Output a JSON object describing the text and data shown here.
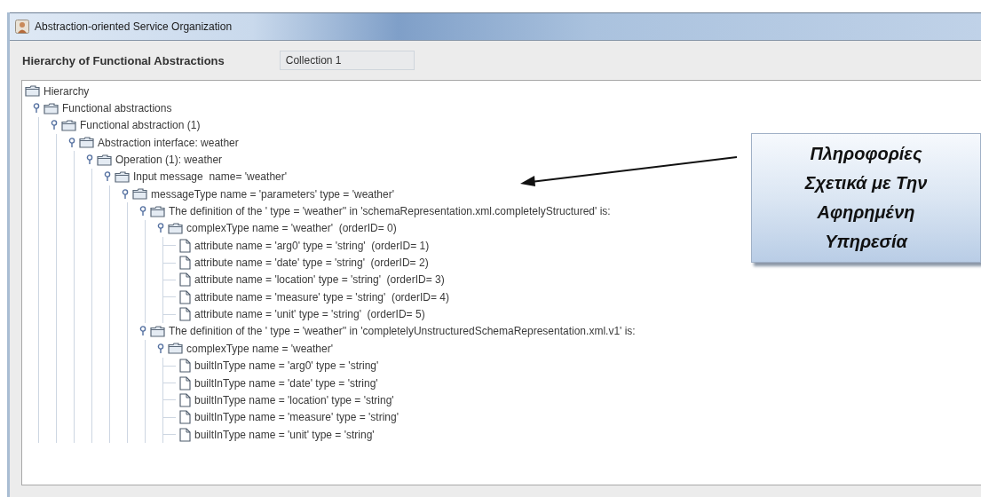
{
  "window": {
    "title": "Abstraction-oriented Service Organization"
  },
  "header": {
    "label": "Hierarchy of Functional Abstractions",
    "field": {
      "value": "Collection 1"
    }
  },
  "tree": {
    "kind": "folder",
    "label": "Hierarchy",
    "children": [
      {
        "kind": "folder",
        "label": "Functional abstractions",
        "expanded": true,
        "children": [
          {
            "kind": "folder",
            "label": "Functional abstraction (1)",
            "expanded": true,
            "children": [
              {
                "kind": "folder",
                "label": "Abstraction interface: weather",
                "expanded": true,
                "children": [
                  {
                    "kind": "folder",
                    "label": "Operation (1): weather",
                    "expanded": true,
                    "children": [
                      {
                        "kind": "folder",
                        "label": "Input message  name= 'weather'",
                        "expanded": true,
                        "children": [
                          {
                            "kind": "folder",
                            "label": "messageType name = 'parameters' type = 'weather'",
                            "expanded": true,
                            "children": [
                              {
                                "kind": "folder",
                                "label": "The definition of the ' type = 'weather'' in 'schemaRepresentation.xml.completelyStructured' is:",
                                "expanded": true,
                                "children": [
                                  {
                                    "kind": "folder",
                                    "label": "complexType name = 'weather'  (orderID= 0)",
                                    "expanded": true,
                                    "children": [
                                      {
                                        "kind": "file",
                                        "label": "attribute name = 'arg0' type = 'string'  (orderID= 1)"
                                      },
                                      {
                                        "kind": "file",
                                        "label": "attribute name = 'date' type = 'string'  (orderID= 2)"
                                      },
                                      {
                                        "kind": "file",
                                        "label": "attribute name = 'location' type = 'string'  (orderID= 3)"
                                      },
                                      {
                                        "kind": "file",
                                        "label": "attribute name = 'measure' type = 'string'  (orderID= 4)"
                                      },
                                      {
                                        "kind": "file",
                                        "label": "attribute name = 'unit' type = 'string'  (orderID= 5)"
                                      }
                                    ]
                                  }
                                ]
                              },
                              {
                                "kind": "folder",
                                "label": "The definition of the ' type = 'weather'' in 'completelyUnstructuredSchemaRepresentation.xml.v1' is:",
                                "expanded": true,
                                "children": [
                                  {
                                    "kind": "folder",
                                    "label": "complexType name = 'weather'",
                                    "expanded": true,
                                    "children": [
                                      {
                                        "kind": "file",
                                        "label": "builtInType name = 'arg0' type = 'string'"
                                      },
                                      {
                                        "kind": "file",
                                        "label": "builtInType name = 'date' type = 'string'"
                                      },
                                      {
                                        "kind": "file",
                                        "label": "builtInType name = 'location' type = 'string'"
                                      },
                                      {
                                        "kind": "file",
                                        "label": "builtInType name = 'measure' type = 'string'"
                                      },
                                      {
                                        "kind": "file",
                                        "label": "builtInType name = 'unit' type = 'string'"
                                      }
                                    ]
                                  }
                                ]
                              }
                            ]
                          }
                        ]
                      }
                    ]
                  }
                ]
              }
            ]
          }
        ]
      }
    ]
  },
  "callout": {
    "text": "Πληροφορίες Σχετικά με Την Αφηρημένη Υπηρεσία"
  }
}
